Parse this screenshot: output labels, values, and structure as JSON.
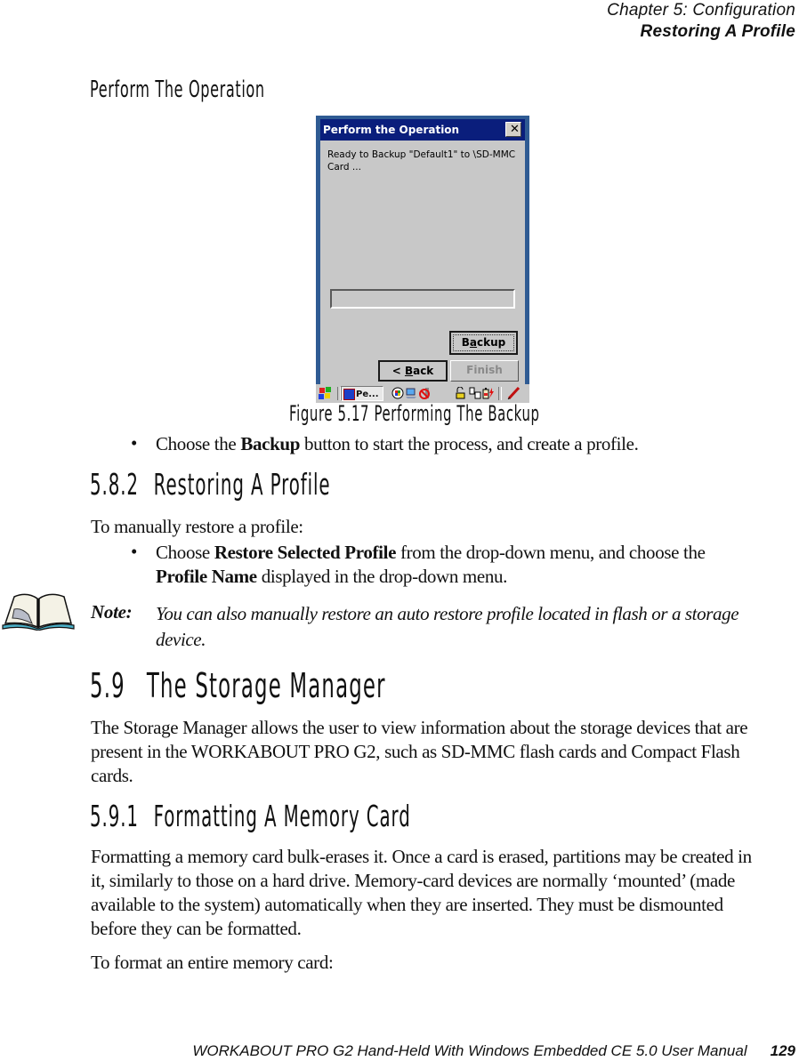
{
  "header": {
    "chapter": "Chapter  5:  Configuration",
    "section": "Restoring A Profile"
  },
  "section_perform": {
    "heading": "Perform The Operation"
  },
  "device_screen": {
    "dialog": {
      "title": "Perform the Operation",
      "close_label": "✕",
      "message": "Ready to Backup \"Default1\" to \\SD-MMC Card ...",
      "progress_fraction": 0,
      "backup_button": {
        "pre": "B",
        "underlined": "a",
        "post": "ckup"
      },
      "back_button": {
        "pre": "< ",
        "underlined": "B",
        "post": "ack"
      },
      "finish_button": "Finish"
    },
    "taskbar": {
      "start_icon": "windows-flag-icon",
      "task_label": "Pe...",
      "tray_icons": [
        "network-globe-icon",
        "network-pc-icon",
        "no-signal-icon",
        "lock-icon",
        "connection-icon",
        "battery-charging-icon",
        "pen-input-icon"
      ]
    }
  },
  "figure": {
    "caption": "Figure 5.17 Performing The Backup"
  },
  "bullet_backup": {
    "pre": "Choose the ",
    "bold": "Backup",
    "post": " button to start the process, and create a profile."
  },
  "section_582": {
    "number": "5.8.2",
    "title": "Restoring A Profile",
    "intro": "To manually restore a profile:",
    "bullet": {
      "pre": "Choose ",
      "bold1": "Restore Selected Profile",
      "mid": " from the drop-down menu, and choose the ",
      "bold2": "Profile Name",
      "post": " displayed in the drop-down menu."
    },
    "note": {
      "label": "Note:",
      "text": "You can also manually restore an auto restore profile located in flash or a storage device."
    }
  },
  "section_59": {
    "number": "5.9",
    "title": "The Storage Manager",
    "body": "The Storage Manager allows the user to view information about the storage devices that are present in the WORKABOUT PRO G2, such as SD-MMC flash cards and Compact Flash cards."
  },
  "section_591": {
    "number": "5.9.1",
    "title": "Formatting A Memory Card",
    "body": "Formatting a memory card bulk-erases it. Once a card is erased, partitions may be created in it, similarly to those on a hard drive. Memory-card devices are normally ‘mounted’ (made available to the system) automatically when they are inserted. They must be dismounted before they can be formatted.",
    "intro2": "To format an entire memory card:"
  },
  "footer": {
    "manual_title": "WORKABOUT PRO G2 Hand-Held With Windows Embedded CE 5.0 User Manual",
    "page_number": "129"
  },
  "bullet_glyph": "•"
}
